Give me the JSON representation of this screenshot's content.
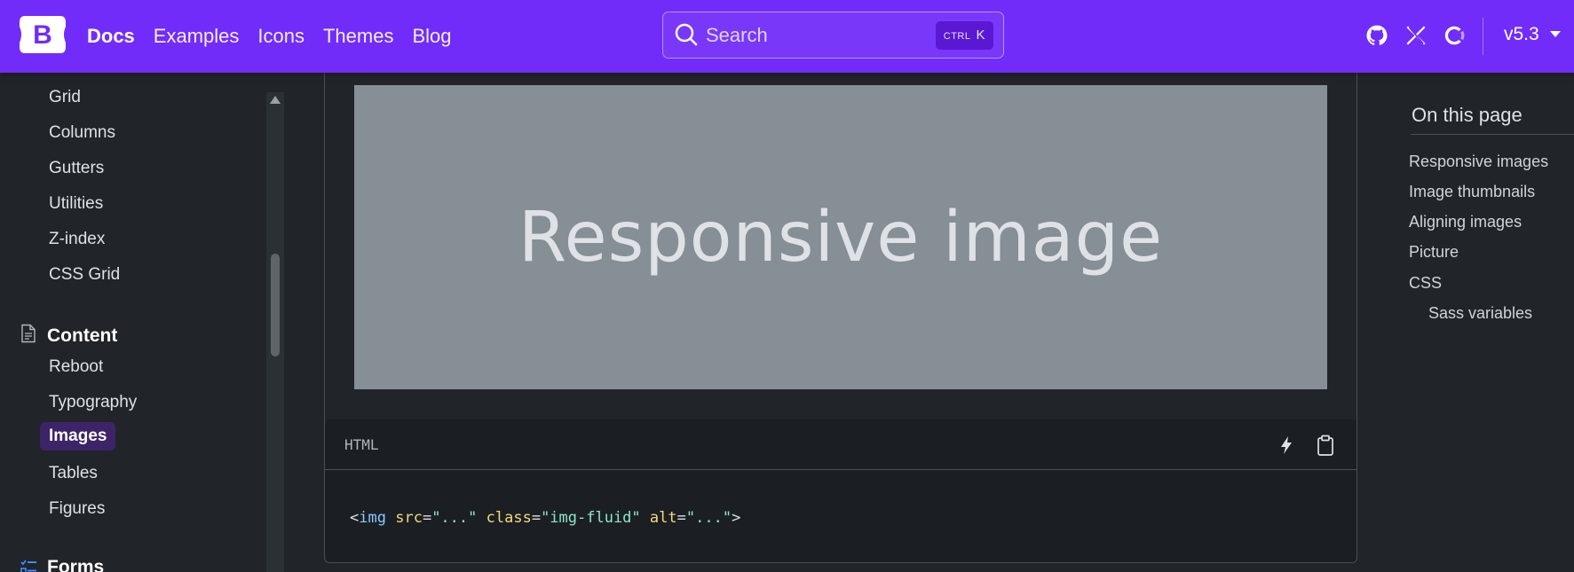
{
  "navbar": {
    "brand_letter": "B",
    "links": [
      "Docs",
      "Examples",
      "Icons",
      "Themes",
      "Blog"
    ],
    "search_placeholder": "Search",
    "search_shortcut_modifier": "CTRL",
    "search_shortcut_key": "K",
    "version": "v5.3",
    "icons": [
      "github-icon",
      "x-twitter-icon",
      "opencollective-icon",
      "chevron-down-icon"
    ],
    "brand_color": "#712cf9"
  },
  "sidebar": {
    "items_top": [
      "Grid",
      "Columns",
      "Gutters",
      "Utilities",
      "Z-index",
      "CSS Grid"
    ],
    "section_content": "Content",
    "items_content": [
      "Reboot",
      "Typography",
      "Images",
      "Tables",
      "Figures"
    ],
    "active_item": "Images",
    "section_forms": "Forms"
  },
  "example": {
    "placeholder_text": "Responsive image",
    "code_lang": "HTML",
    "code": {
      "open": "<",
      "tag": "img",
      "attr1": "src",
      "eq": "=",
      "val1": "\"...\"",
      "attr2": "class",
      "val2": "\"img-fluid\"",
      "attr3": "alt",
      "val3": "\"...\"",
      "close": ">"
    }
  },
  "toc": {
    "title": "On this page",
    "items": [
      "Responsive images",
      "Image thumbnails",
      "Aligning images",
      "Picture",
      "CSS"
    ],
    "sub_items": [
      "Sass variables"
    ]
  }
}
